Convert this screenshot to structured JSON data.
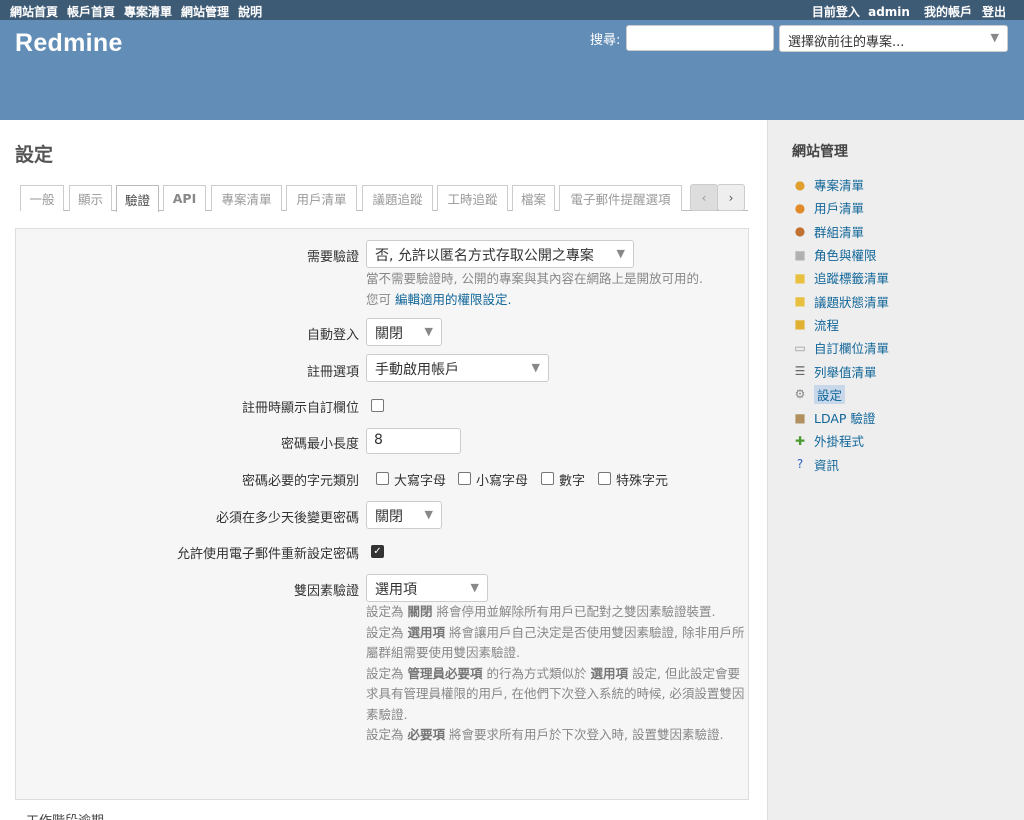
{
  "top_menu": {
    "left": [
      "網站首頁",
      "帳戶首頁",
      "專案清單",
      "網站管理",
      "說明"
    ],
    "logged_in_as": "目前登入",
    "user": "admin",
    "my_account": "我的帳戶",
    "logout": "登出"
  },
  "header": {
    "title": "Redmine",
    "search_label": "搜尋:",
    "search_value": "",
    "project_jump": "選擇欲前往的專案..."
  },
  "sidebar": {
    "title": "網站管理",
    "items": [
      {
        "label": "專案清單",
        "icon": "projects-icon",
        "glyph": "●",
        "color": "#e0a030"
      },
      {
        "label": "用戶清單",
        "icon": "user-icon",
        "glyph": "●",
        "color": "#e08a2a"
      },
      {
        "label": "群組清單",
        "icon": "group-icon",
        "glyph": "●",
        "color": "#c07030"
      },
      {
        "label": "角色與權限",
        "icon": "roles-icon",
        "glyph": "■",
        "color": "#b0b0b0"
      },
      {
        "label": "追蹤標籤清單",
        "icon": "tracker-icon",
        "glyph": "■",
        "color": "#e8c040"
      },
      {
        "label": "議題狀態清單",
        "icon": "issue-status-icon",
        "glyph": "■",
        "color": "#e8c040"
      },
      {
        "label": "流程",
        "icon": "workflow-icon",
        "glyph": "■",
        "color": "#e0b030"
      },
      {
        "label": "自訂欄位清單",
        "icon": "custom-fields-icon",
        "glyph": "▭",
        "color": "#999999"
      },
      {
        "label": "列舉值清單",
        "icon": "list-icon",
        "glyph": "☰",
        "color": "#666666"
      },
      {
        "label": "設定",
        "icon": "gear-icon",
        "glyph": "⚙",
        "color": "#888888",
        "selected": true
      },
      {
        "label": "LDAP 驗證",
        "icon": "ldap-icon",
        "glyph": "■",
        "color": "#b09060"
      },
      {
        "label": "外掛程式",
        "icon": "plugin-icon",
        "glyph": "✚",
        "color": "#4a9a30"
      },
      {
        "label": "資訊",
        "icon": "help-icon",
        "glyph": "?",
        "color": "#3060c0"
      }
    ]
  },
  "page": {
    "title": "設定",
    "tabs": [
      "一般",
      "顯示",
      "驗證",
      "API",
      "專案清單",
      "用戶清單",
      "議題追蹤",
      "工時追蹤",
      "檔案",
      "電子郵件提醒選項"
    ],
    "selected_tab": "驗證",
    "tab_prev": "‹",
    "tab_next": "›"
  },
  "form": {
    "login_required": {
      "label": "需要驗證",
      "value": "否, 允許以匿名方式存取公開之專案",
      "info1": "當不需要驗證時, 公開的專案與其內容在網路上是開放可用的.",
      "info2_prefix": "您可",
      "info2_link": "編輯適用的權限設定."
    },
    "autologin": {
      "label": "自動登入",
      "value": "關閉"
    },
    "self_registration": {
      "label": "註冊選項",
      "value": "手動啟用帳戶"
    },
    "show_custom_fields": {
      "label": "註冊時顯示自訂欄位",
      "checked": false
    },
    "password_min_length": {
      "label": "密碼最小長度",
      "value": "8"
    },
    "password_required_chars": {
      "label": "密碼必要的字元類別",
      "options": [
        "大寫字母",
        "小寫字母",
        "數字",
        "特殊字元"
      ]
    },
    "password_max_age": {
      "label": "必須在多少天後變更密碼",
      "value": "關閉"
    },
    "lost_password": {
      "label": "允許使用電子郵件重新設定密碼",
      "checked": true,
      "check_glyph": "✓"
    },
    "twofa": {
      "label": "雙因素驗證",
      "value": "選用項",
      "p1_a": "設定為",
      "p1_b": "關閉",
      "p1_c": "將會停用並解除所有用戶已配對之雙因素驗證裝置.",
      "p2_a": "設定為",
      "p2_b": "選用項",
      "p2_c": "將會讓用戶自己決定是否使用雙因素驗證, 除非用戶所屬群組需要使用雙因素驗證.",
      "p3_a": "設定為",
      "p3_b": "管理員必要項",
      "p3_c": "的行為方式類似於",
      "p3_d": "選用項",
      "p3_e": "設定, 但此設定會要求具有管理員權限的用戶, 在他們下次登入系統的時候, 必須設置雙因素驗證.",
      "p4_a": "設定為",
      "p4_b": "必要項",
      "p4_c": "將會要求所有用戶於下次登入時, 設置雙因素驗證."
    },
    "next_section": "工作階段逾期"
  }
}
